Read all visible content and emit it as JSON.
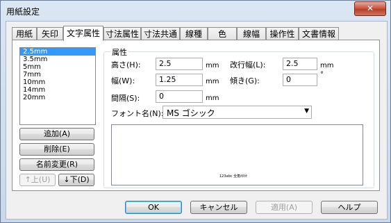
{
  "window": {
    "title": "用紙設定",
    "close_label": "✕"
  },
  "tabs": [
    {
      "label": "用紙"
    },
    {
      "label": "矢印"
    },
    {
      "label": "文字属性",
      "active": true
    },
    {
      "label": "寸法属性"
    },
    {
      "label": "寸法共通"
    },
    {
      "label": "線種"
    },
    {
      "label": "色"
    },
    {
      "label": "線幅"
    },
    {
      "label": "操作性"
    },
    {
      "label": "文書情報"
    }
  ],
  "size_list": [
    "2.5mm",
    "3.5mm",
    "5mm",
    "7mm",
    "10mm",
    "14mm",
    "20mm"
  ],
  "selected_size": "2.5mm",
  "list_buttons": {
    "add": "追加(A)",
    "delete": "削除(E)",
    "rename": "名前変更(R)",
    "up": "↑上(U)",
    "down": "↓下(D)"
  },
  "group": {
    "title": "属性",
    "height_label": "高さ(H):",
    "height_value": "2.5",
    "height_unit": "mm",
    "width_label": "幅(W):",
    "width_value": "1.25",
    "width_unit": "mm",
    "spacing_label": "間隔(S):",
    "spacing_value": "0",
    "spacing_unit": "mm",
    "linespace_label": "改行幅(L):",
    "linespace_value": "2.5",
    "linespace_unit": "mm",
    "slant_label": "傾き(G):",
    "slant_value": "0",
    "slant_unit": "°",
    "font_label": "フォント名(N):",
    "font_value": "MS ゴシック",
    "preview_text": "123abc 全角ｶﾀｶﾅ"
  },
  "footer": {
    "ok": "OK",
    "cancel": "キャンセル",
    "apply": "適用(A)",
    "help": "ヘルプ"
  }
}
